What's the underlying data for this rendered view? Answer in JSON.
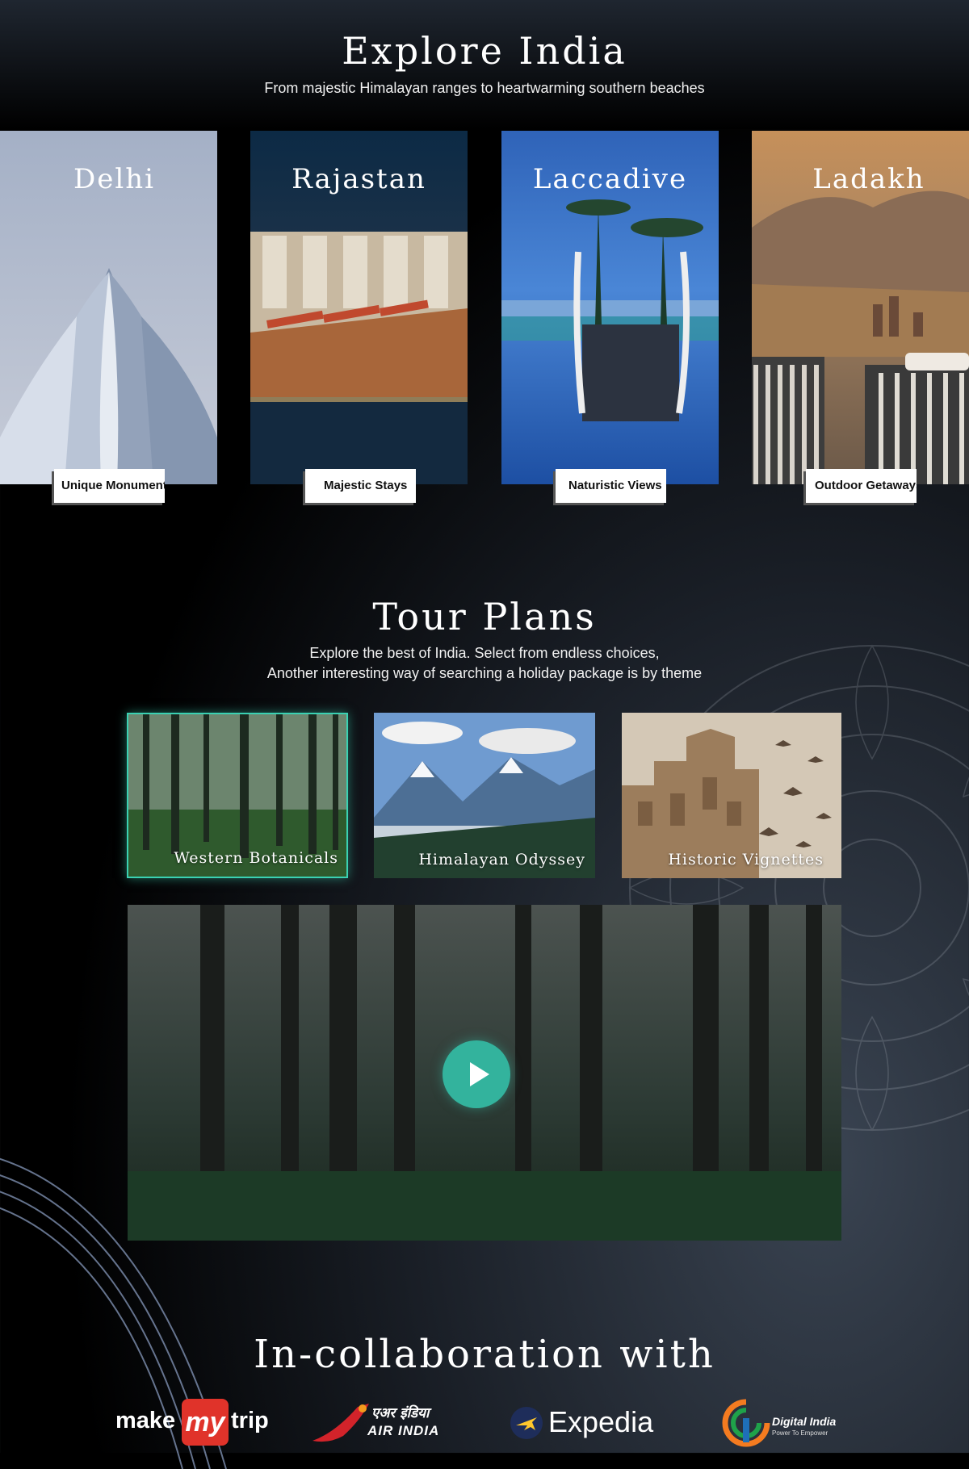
{
  "explore": {
    "title": "Explore India",
    "subtitle": "From majestic Himalayan ranges to heartwarming southern beaches",
    "destinations": [
      {
        "name": "Delhi",
        "tag": "Unique Monuments"
      },
      {
        "name": "Rajastan",
        "tag": "Majestic Stays"
      },
      {
        "name": "Laccadive",
        "tag": "Naturistic Views"
      },
      {
        "name": "Ladakh",
        "tag": "Outdoor Getaways"
      }
    ]
  },
  "tours": {
    "title": "Tour Plans",
    "subtitle_line1": "Explore the best of India. Select from endless choices,",
    "subtitle_line2": "Another interesting way of searching a holiday package is by theme",
    "themes": [
      {
        "label": "Western Botanicals",
        "active": true
      },
      {
        "label": "Himalayan Odyssey",
        "active": false
      },
      {
        "label": "Historic Vignettes",
        "active": false
      }
    ],
    "video": {
      "icon": "play-icon"
    }
  },
  "collab": {
    "title": "In-collaboration with",
    "partners": [
      {
        "name": "makemytrip",
        "text_a": "make",
        "text_b": "my",
        "text_c": "trip"
      },
      {
        "name": "air-india",
        "text_a": "एअर इंडिया",
        "text_b": "AIR INDIA"
      },
      {
        "name": "expedia",
        "text": "Expedia"
      },
      {
        "name": "digital-india",
        "text_a": "Digital India",
        "text_b": "Power To Empower"
      }
    ]
  },
  "colors": {
    "accent": "#33b39d",
    "background": "#000000"
  }
}
